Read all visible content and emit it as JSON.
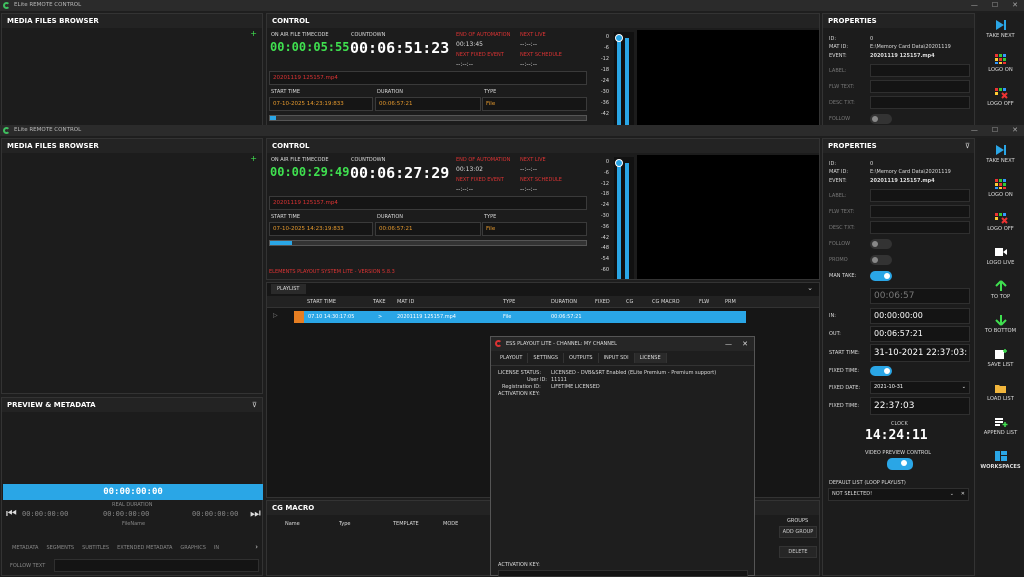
{
  "top_window": {
    "title": "ELite REMOTE CONTROL",
    "media_title": "MEDIA FILES BROWSER",
    "control_title": "CONTROL",
    "properties_title": "PROPERTIES",
    "on_air_label": "ON AIR FILE TIMECODE",
    "on_air_value": "00:00:05:55",
    "countdown_label": "COUNTDOWN",
    "countdown_value": "00:06:51:23",
    "end_auto_label": "END OF AUTOMATION",
    "end_auto_value": "00:13:45",
    "next_live_label": "NEXT LIVE",
    "next_live_value": "--:--:--",
    "next_fixed_label": "NEXT FIXED EVENT",
    "next_fixed_value": "--:--:--",
    "next_schedule_label": "NEXT SCHEDULE",
    "next_schedule_value": "--:--:--",
    "current_file": "20201119 125157.mp4",
    "start_time_label": "START TIME",
    "start_time_value": "07-10-2025 14:23:19:833",
    "duration_label": "DURATION",
    "duration_value": "00:06:57:21",
    "type_label": "TYPE",
    "type_value": "File",
    "prop_id_label": "ID:",
    "prop_id_value": "0",
    "prop_matid_label": "MAT ID:",
    "prop_matid_value": "E:\\Memory Card Data\\20201119",
    "prop_event_label": "EVENT:",
    "prop_event_value": "20201119 125157.mp4",
    "prop_label": "LABEL:",
    "prop_flw": "FLW TEXT:",
    "prop_desc": "DESC TXT:",
    "prop_follow": "FOLLOW",
    "scale": [
      "0",
      "-6",
      "-12",
      "-18",
      "-24",
      "-30",
      "-36",
      "-42"
    ]
  },
  "toolbar_top": {
    "take_next": "TAKE NEXT",
    "logo_on": "LOGO ON",
    "logo_off": "LOGO OFF"
  },
  "main": {
    "title": "ELite REMOTE CONTROL",
    "media_title": "MEDIA FILES BROWSER",
    "control_title": "CONTROL",
    "properties_title": "PROPERTIES",
    "on_air_label": "ON AIR FILE TIMECODE",
    "on_air_value": "00:00:29:49",
    "countdown_label": "COUNTDOWN",
    "countdown_value": "00:06:27:29",
    "end_auto_label": "END OF AUTOMATION",
    "end_auto_value": "00:13:02",
    "next_live_label": "NEXT LIVE",
    "next_live_value": "--:--:--",
    "next_fixed_label": "NEXT FIXED EVENT",
    "next_fixed_value": "--:--:--",
    "next_schedule_label": "NEXT SCHEDULE",
    "next_schedule_value": "--:--:--",
    "current_file": "20201119 125157.mp4",
    "start_time_label": "START TIME",
    "start_time_value": "07-10-2025 14:23:19:833",
    "duration_label": "DURATION",
    "duration_value": "00:06:57:21",
    "type_label": "TYPE",
    "type_value": "File",
    "version": "ELEMENTS PLAYOUT SYSTEM LITE - VERSION 5.8.3",
    "scale": [
      "0",
      "-6",
      "-12",
      "-18",
      "-24",
      "-30",
      "-36",
      "-42",
      "-48",
      "-54",
      "-60"
    ],
    "playlist_tab": "PLAYLIST",
    "playlist_headers": [
      "START TIME",
      "TAKE",
      "MAT ID",
      "TYPE",
      "DURATION",
      "FIXED",
      "CG",
      "CG MACRO",
      "FLW",
      "PRM"
    ],
    "playlist_row": {
      "start": "07.10 14:30:17:05",
      "take": ">",
      "matid": "20201119 125157.mp4",
      "type": "File",
      "duration": "00:06:57:21"
    },
    "preview_title": "PREVIEW & METADATA",
    "preview_timecode": "00:00:00:00",
    "real_duration_label": "REAL DURATION",
    "real_duration_value": "00:00:00:00",
    "in_tc": "00:00:00:00",
    "out_tc": "00:00:00:00",
    "filename_label": "FileName",
    "meta_tabs": [
      "METADATA",
      "SEGMENTS",
      "SUBTITLES",
      "EXTENDED METADATA",
      "GRAPHICS",
      "IN"
    ],
    "follow_text_label": "FOLLOW TEXT",
    "cg_title": "CG MACRO",
    "cg_headers": [
      "Name",
      "Type",
      "TEMPLATE",
      "MODE"
    ],
    "groups_label": "GROUPS",
    "add_group": "ADD GROUP",
    "delete": "DELETE",
    "props": {
      "id_label": "ID:",
      "id_value": "0",
      "matid_label": "MAT ID:",
      "matid_value": "E:\\Memory Card Data\\20201119",
      "event_label": "EVENT:",
      "event_value": "20201119 125157.mp4",
      "label": "LABEL:",
      "flw": "FLW TEXT:",
      "desc": "DESC TXT:",
      "follow": "FOLLOW",
      "promo": "PROMO",
      "man_take": "MAN TAKE:",
      "duration_value": "00:06:57",
      "in_label": "IN:",
      "in_value": "00:00:00:00",
      "out_label": "OUT:",
      "out_value": "00:06:57:21",
      "start_time_label": "START TIME:",
      "start_time_value": "31-10-2021 22:37:03:",
      "fixed_time_label": "FIXED TIME:",
      "fixed_date_label": "FIXED DATE:",
      "fixed_date_value": "2021-10-31",
      "fixed_time2_label": "FIXED TIME:",
      "fixed_time2_value": "22:37:03",
      "clock_label": "CLOCK",
      "clock_value": "14:24:11",
      "video_preview_label": "VIDEO PREVIEW CONTROL",
      "default_list_label": "DEFAULT LIST (LOOP PLAYLIST)",
      "default_list_value": "NOT SELECTED!"
    }
  },
  "toolbar": {
    "take_next": "TAKE NEXT",
    "logo_on": "LOGO ON",
    "logo_off": "LOGO OFF",
    "logo_live": "LOGO LIVE",
    "to_top": "TO TOP",
    "to_bottom": "TO BOTTOM",
    "save_list": "SAVE LIST",
    "load_list": "LOAD LIST",
    "append_list": "APPEND LIST",
    "workspaces": "WORKSPACES"
  },
  "dialog": {
    "title": "ESS PLAYOUT LITE - CHANNEL: MY CHANNEL",
    "tabs": [
      "PLAYOUT",
      "SETTINGS",
      "OUTPUTS",
      "INPUT SDI",
      "LICENSE"
    ],
    "license_status_label": "LICENSE STATUS:",
    "license_status_value": "LICENSED - DVB&SRT Enabled (ELite Premium - Premium support)",
    "user_id_label": "User ID:",
    "user_id_value": "11111",
    "reg_id_label": "Registration ID:",
    "reg_id_value": "LIFETIME LICENSED",
    "activation_label": "ACTIVATION KEY:",
    "activation_key_label2": "ACTIVATION KEY:"
  },
  "colors": {
    "accent": "#2aa6e6",
    "green": "#3fe04f",
    "red": "#d33333",
    "orange": "#e69a2e"
  }
}
